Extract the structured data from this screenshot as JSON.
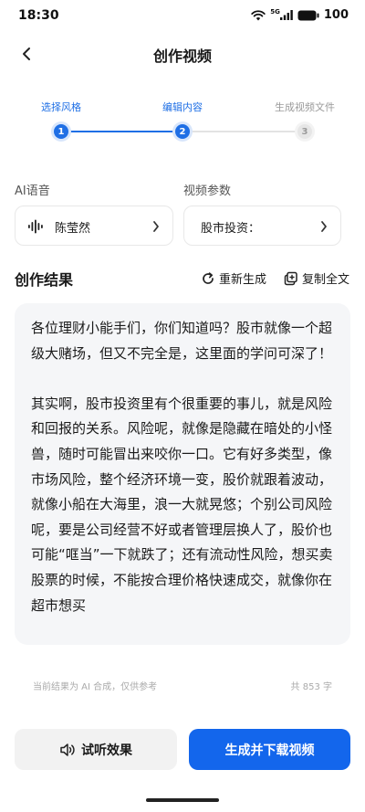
{
  "status_bar": {
    "time": "18:30",
    "network": "5G",
    "battery": "100"
  },
  "nav": {
    "title": "创作视频"
  },
  "steps": [
    {
      "label": "选择风格",
      "number": "1",
      "state": "active"
    },
    {
      "label": "编辑内容",
      "number": "2",
      "state": "active"
    },
    {
      "label": "生成视频文件",
      "number": "3",
      "state": "inactive"
    }
  ],
  "params": {
    "voice_label": "AI语音",
    "voice_value": "陈莹然",
    "video_label": "视频参数",
    "video_value": "股市投资："
  },
  "result": {
    "title": "创作结果",
    "regenerate": "重新生成",
    "copy_all": "复制全文",
    "paragraphs": [
      "各位理财小能手们，你们知道吗？股市就像一个超级大赌场，但又不完全是，这里面的学问可深了！",
      "其实啊，股市投资里有个很重要的事儿，就是风险和回报的关系。风险呢，就像是隐藏在暗处的小怪兽，随时可能冒出来咬你一口。它有好多类型，像市场风险，整个经济环境一变，股价就跟着波动，就像小船在大海里，浪一大就晃悠；个别公司风险呢，要是公司经营不好或者管理层换人了，股价也可能“哐当”一下就跌了；还有流动性风险，想买卖股票的时候，不能按合理价格快速成交，就像你在超市想买"
    ],
    "disclaimer": "当前结果为 AI 合成，仅供参考",
    "word_count": "共 853 字"
  },
  "buttons": {
    "listen": "试听效果",
    "generate": "生成并下载视频"
  },
  "colors": {
    "accent": "#1f6fe5",
    "primary_button": "#1366ec",
    "text_box_bg": "#f5f6f8"
  }
}
